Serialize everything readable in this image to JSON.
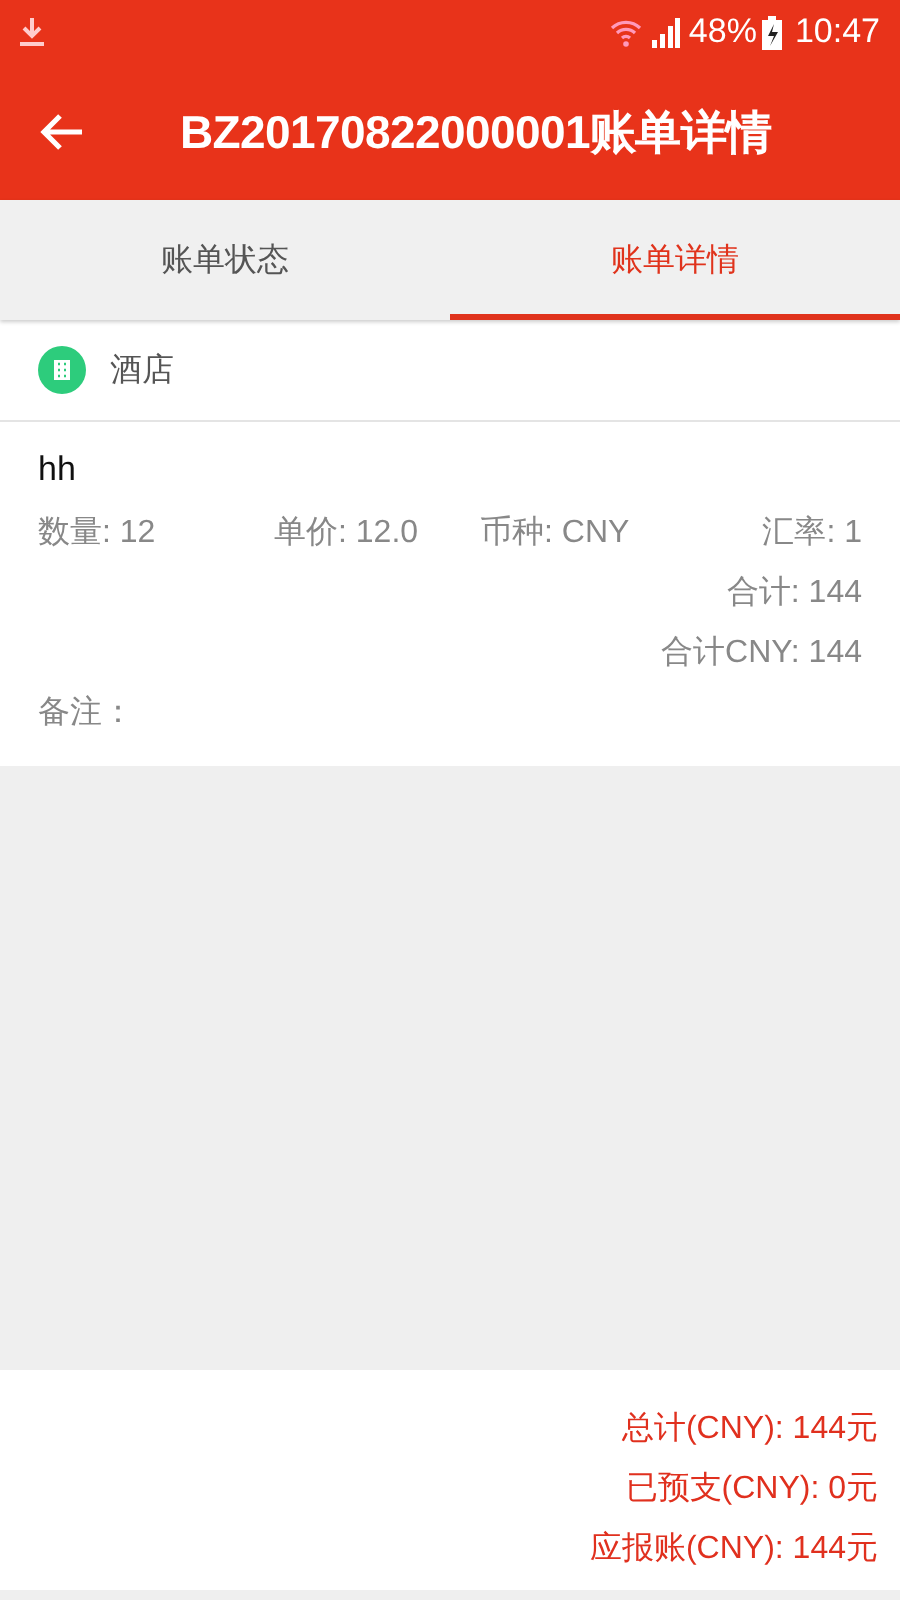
{
  "status_bar": {
    "battery_percent": "48%",
    "time": "10:47"
  },
  "header": {
    "title": "BZ20170822000001账单详情"
  },
  "tabs": [
    {
      "label": "账单状态",
      "selected": false
    },
    {
      "label": "账单详情",
      "selected": true
    }
  ],
  "category": {
    "label": "酒店"
  },
  "item": {
    "name": "hh",
    "quantity": "数量: 12",
    "unit_price": "单价: 12.0",
    "currency": "币种: CNY",
    "rate": "汇率: 1",
    "total": "合计: 144",
    "total_cny": "合计CNY: 144",
    "remark": "备注："
  },
  "summary": [
    "总计(CNY): 144元",
    "已预支(CNY): 0元",
    "应报账(CNY): 144元"
  ]
}
